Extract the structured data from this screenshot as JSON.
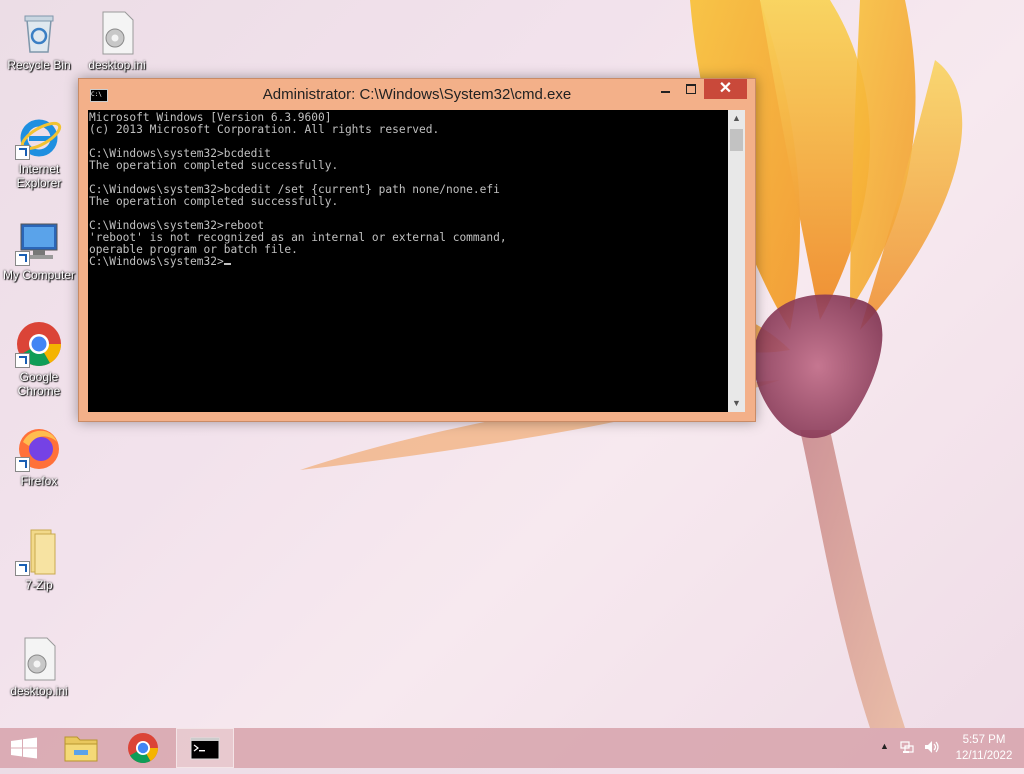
{
  "desktop": {
    "icons": [
      {
        "label": "Recycle Bin"
      },
      {
        "label": "desktop.ini"
      },
      {
        "label": "Internet Explorer"
      },
      {
        "label": "My Computer"
      },
      {
        "label": "Google Chrome"
      },
      {
        "label": "Firefox"
      },
      {
        "label": "7-Zip"
      },
      {
        "label": "desktop.ini"
      }
    ]
  },
  "cmd_window": {
    "title": "Administrator: C:\\Windows\\System32\\cmd.exe",
    "icon_text": "C:\\",
    "close_glyph": "✕",
    "output": "Microsoft Windows [Version 6.3.9600]\n(c) 2013 Microsoft Corporation. All rights reserved.\n\nC:\\Windows\\system32>bcdedit\nThe operation completed successfully.\n\nC:\\Windows\\system32>bcdedit /set {current} path none/none.efi\nThe operation completed successfully.\n\nC:\\Windows\\system32>reboot\n'reboot' is not recognized as an internal or external command,\noperable program or batch file.\n",
    "prompt": "C:\\Windows\\system32>",
    "scroll_up_glyph": "▲",
    "scroll_down_glyph": "▼"
  },
  "taskbar": {
    "items": [
      {
        "name": "start-button"
      },
      {
        "name": "file-explorer"
      },
      {
        "name": "google-chrome"
      },
      {
        "name": "command-prompt",
        "active": true
      }
    ],
    "tray": {
      "chevron": "▲",
      "time": "5:57 PM",
      "date": "12/11/2022"
    }
  },
  "colors": {
    "cmd_frame": "#f3b089",
    "close_button": "#c9493a",
    "console_bg": "#000000",
    "console_text": "#c0c0c0",
    "taskbar": "#d5a0a8"
  }
}
